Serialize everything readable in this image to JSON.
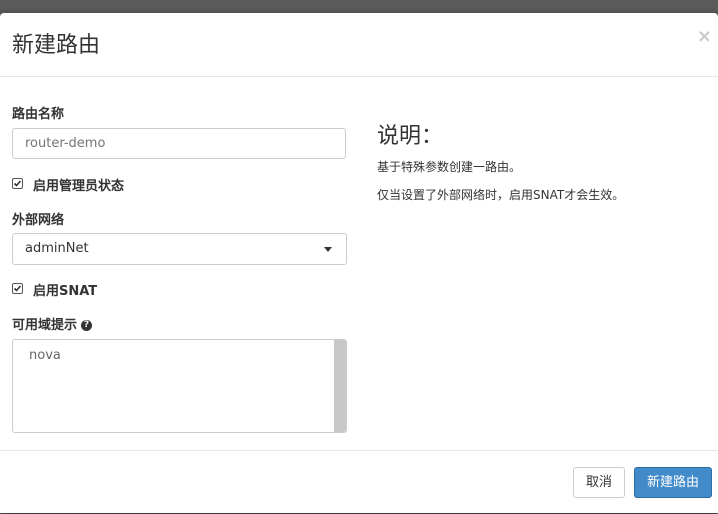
{
  "modal": {
    "title": "新建路由",
    "close_symbol": "×"
  },
  "form": {
    "router_name_label": "路由名称",
    "router_name_value": "router-demo",
    "admin_state_label": "启用管理员状态",
    "admin_state_checked": true,
    "external_network_label": "外部网络",
    "external_network_value": "adminNet",
    "enable_snat_label": "启用SNAT",
    "enable_snat_checked": true,
    "az_hints_label": "可用域提示",
    "az_hints_options": [
      "nova"
    ]
  },
  "description": {
    "title": "说明：",
    "lines": [
      "基于特殊参数创建一路由。",
      "仅当设置了外部网络时，启用SNAT才会生效。"
    ]
  },
  "footer": {
    "cancel_label": "取消",
    "submit_label": "新建路由"
  },
  "icons": {
    "close": "close-icon",
    "checkbox": "checkbox-checked-icon",
    "help": "help-icon",
    "dropdown": "chevron-down-icon"
  },
  "colors": {
    "primary": "#428bca",
    "backdrop": "#5b5b5b"
  }
}
